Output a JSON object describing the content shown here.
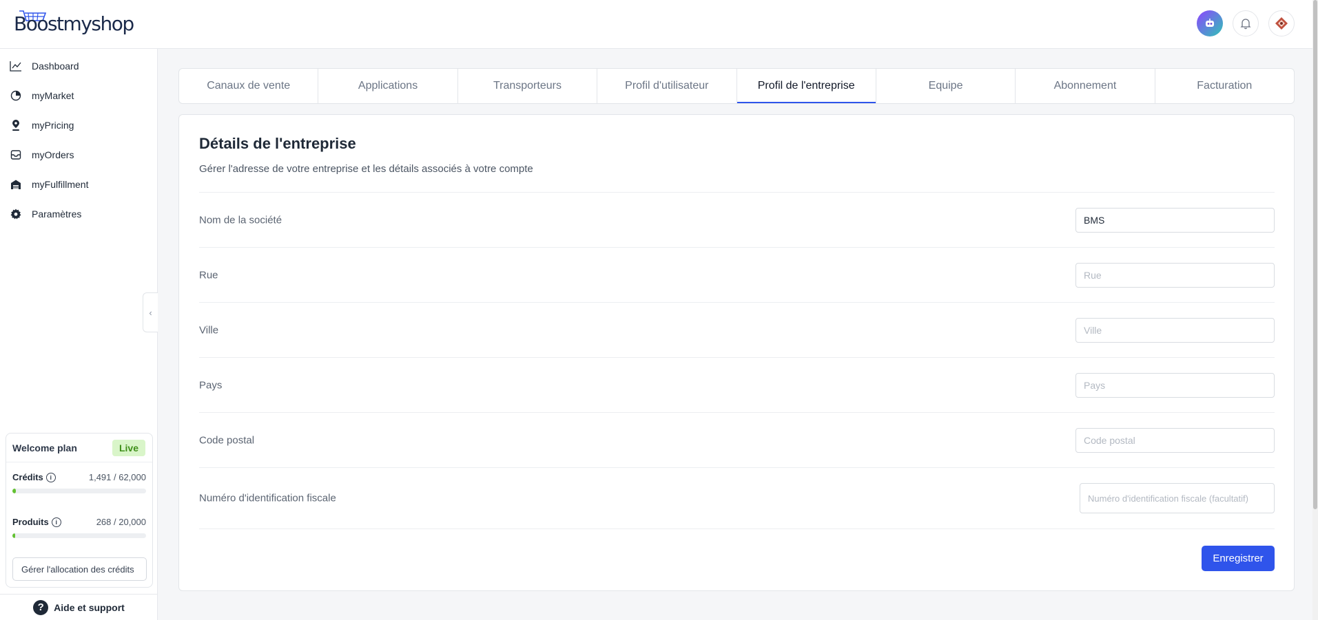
{
  "app": {
    "logo_text": "Boostmyshop"
  },
  "sidebar": {
    "items": [
      {
        "label": "Dashboard",
        "icon": "chart-line-icon"
      },
      {
        "label": "myMarket",
        "icon": "pie-chart-icon"
      },
      {
        "label": "myPricing",
        "icon": "pin-icon"
      },
      {
        "label": "myOrders",
        "icon": "inbox-icon"
      },
      {
        "label": "myFulfillment",
        "icon": "warehouse-icon"
      },
      {
        "label": "Paramètres",
        "icon": "gear-icon"
      }
    ],
    "plan": {
      "name": "Welcome plan",
      "status": "Live",
      "credits": {
        "label": "Crédits",
        "value": "1,491 / 62,000",
        "fraction": 0.024
      },
      "products": {
        "label": "Produits",
        "value": "268 / 20,000",
        "fraction": 0.013
      },
      "allocation_button": "Gérer l'allocation des crédits"
    },
    "help": "Aide et support"
  },
  "tabs": [
    {
      "label": "Canaux de vente",
      "active": false
    },
    {
      "label": "Applications",
      "active": false
    },
    {
      "label": "Transporteurs",
      "active": false
    },
    {
      "label": "Profil d'utilisateur",
      "active": false
    },
    {
      "label": "Profil de l'entreprise",
      "active": true
    },
    {
      "label": "Equipe",
      "active": false
    },
    {
      "label": "Abonnement",
      "active": false
    },
    {
      "label": "Facturation",
      "active": false
    }
  ],
  "form": {
    "title": "Détails de l'entreprise",
    "subtitle": "Gérer l'adresse de votre entreprise et les détails associés à votre compte",
    "fields": [
      {
        "label": "Nom de la société",
        "value": "BMS",
        "placeholder": ""
      },
      {
        "label": "Rue",
        "value": "",
        "placeholder": "Rue"
      },
      {
        "label": "Ville",
        "value": "",
        "placeholder": "Ville"
      },
      {
        "label": "Pays",
        "value": "",
        "placeholder": "Pays"
      },
      {
        "label": "Code postal",
        "value": "",
        "placeholder": "Code postal"
      },
      {
        "label": "Numéro d'identification fiscale",
        "value": "",
        "placeholder": "Numéro d'identification fiscale (facultatif)"
      }
    ],
    "save_label": "Enregistrer"
  },
  "colors": {
    "accent": "#2f54eb",
    "live_bg": "#d9f5c9",
    "live_text": "#3f8f1a",
    "progress": "#63c132"
  }
}
